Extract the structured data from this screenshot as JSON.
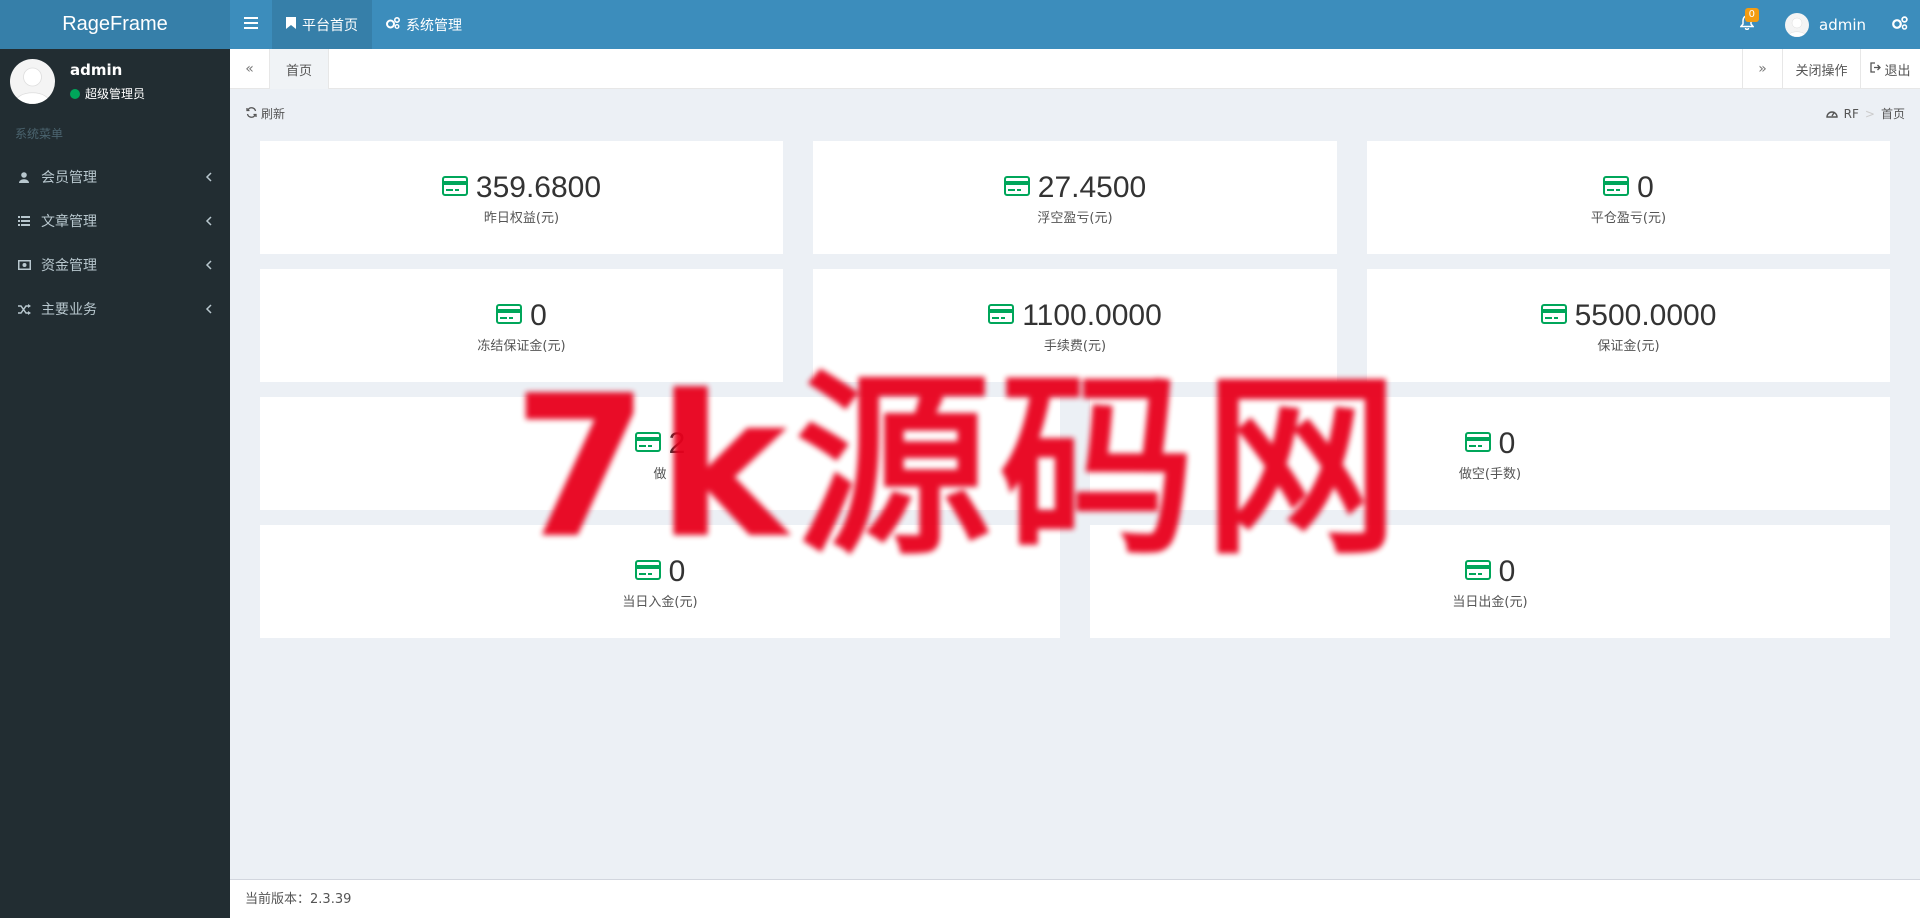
{
  "app": {
    "title": "RageFrame"
  },
  "topnav": {
    "items": [
      {
        "label": "平台首页",
        "icon": "bookmark-icon",
        "active": true
      },
      {
        "label": "系统管理",
        "icon": "cogs-icon",
        "active": false
      }
    ]
  },
  "header": {
    "notifications": {
      "count": "0"
    },
    "user": {
      "name": "admin"
    }
  },
  "sidebar": {
    "user": {
      "name": "admin",
      "role": "超级管理员",
      "status_color": "#00a65a"
    },
    "menu_header": "系统菜单",
    "items": [
      {
        "label": "会员管理",
        "icon": "user-icon"
      },
      {
        "label": "文章管理",
        "icon": "list-icon"
      },
      {
        "label": "资金管理",
        "icon": "money-icon"
      },
      {
        "label": "主要业务",
        "icon": "random-icon"
      }
    ]
  },
  "tabs": {
    "prev": "«",
    "home": "首页",
    "next": "»",
    "close_ops": "关闭操作",
    "logout": "退出"
  },
  "content": {
    "refresh": "刷新",
    "breadcrumb": {
      "root": "RF",
      "sep": ">",
      "current": "首页"
    }
  },
  "stats": [
    {
      "value": "359.6800",
      "label": "昨日权益(元)"
    },
    {
      "value": "27.4500",
      "label": "浮空盈亏(元)"
    },
    {
      "value": "0",
      "label": "平仓盈亏(元)"
    },
    {
      "value": "0",
      "label": "冻结保证金(元)"
    },
    {
      "value": "1100.0000",
      "label": "手续费(元)"
    },
    {
      "value": "5500.0000",
      "label": "保证金(元)"
    },
    {
      "value": "2",
      "label": "做"
    },
    {
      "value": "0",
      "label": "做空(手数)"
    },
    {
      "value": "0",
      "label": "当日入金(元)"
    },
    {
      "value": "0",
      "label": "当日出金(元)"
    }
  ],
  "footer": {
    "version_label": "当前版本：",
    "version": "2.3.39"
  },
  "watermark": "7k源码网",
  "colors": {
    "header": "#3c8dbc",
    "sidebar": "#222d32",
    "icon_green": "#00a65a",
    "watermark": "#e8001c"
  }
}
